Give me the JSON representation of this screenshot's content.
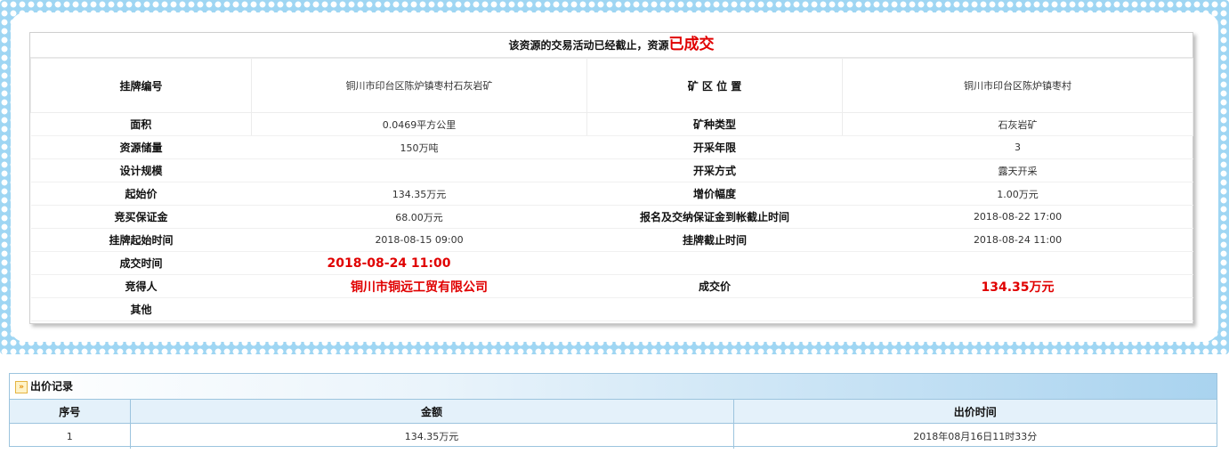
{
  "notice": {
    "prefix": "该资源的交易活动已经截止，资源",
    "status": "已成交"
  },
  "rows": [
    {
      "label1": "挂牌编号",
      "value1": "铜川市印台区陈炉镇枣村石灰岩矿",
      "label2": "矿 区 位 置",
      "value2": "铜川市印台区陈炉镇枣村"
    },
    {
      "label1": "面积",
      "value1": "0.0469平方公里",
      "label2": "矿种类型",
      "value2": "石灰岩矿"
    },
    {
      "label1": "资源储量",
      "value1": "150万吨",
      "label2": "开采年限",
      "value2": "3"
    },
    {
      "label1": "设计规模",
      "value1": "",
      "label2": "开采方式",
      "value2": "露天开采"
    },
    {
      "label1": "起始价",
      "value1": "134.35万元",
      "label2": "增价幅度",
      "value2": "1.00万元"
    },
    {
      "label1": "竞买保证金",
      "value1": "68.00万元",
      "label2": "报名及交纳保证金到帐截止时间",
      "value2": "2018-08-22 17:00"
    },
    {
      "label1": "挂牌起始时间",
      "value1": "2018-08-15 09:00",
      "label2": "挂牌截止时间",
      "value2": "2018-08-24 11:00"
    }
  ],
  "deal": {
    "time_label": "成交时间",
    "time_value": "2018-08-24 11:00",
    "winner_label": "竞得人",
    "winner_value": "铜川市铜远工贸有限公司",
    "price_label": "成交价",
    "price_value": "134.35万元",
    "other_label": "其他"
  },
  "records": {
    "title": "出价记录",
    "headers": [
      "序号",
      "金额",
      "出价时间"
    ],
    "rows": [
      {
        "index": "1",
        "amount": "134.35万元",
        "time": "2018年08月16日11时33分"
      }
    ]
  },
  "colors": {
    "frame": "#9fd6f3",
    "highlight": "#e00000",
    "table_border": "#9cc4de"
  }
}
